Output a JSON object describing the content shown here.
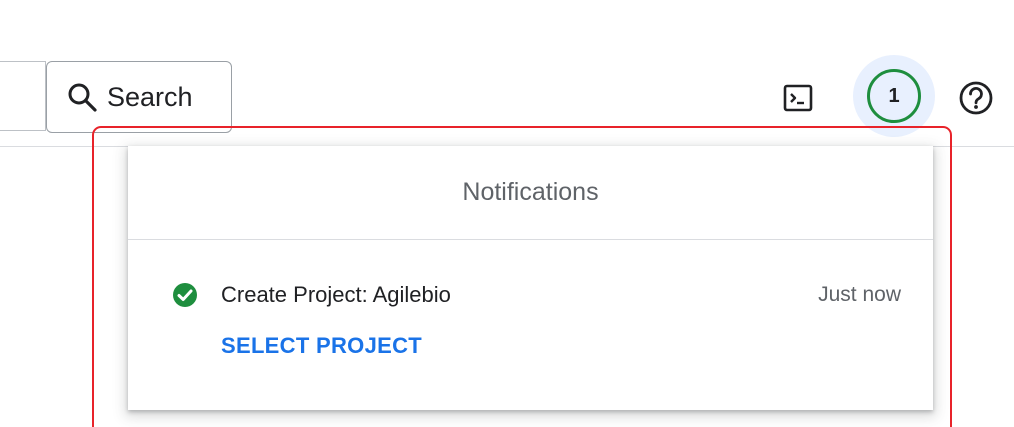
{
  "header": {
    "search": {
      "label": "Search",
      "icon": "search-icon"
    },
    "notifications": {
      "count": "1",
      "ring_color": "#1e8e3e"
    },
    "terminal_icon": "terminal-icon",
    "help_icon": "help-icon"
  },
  "notifications_panel": {
    "title": "Notifications",
    "items": [
      {
        "status": "success",
        "status_color": "#1e8e3e",
        "title": "Create Project: Agilebio",
        "time": "Just now",
        "action": "SELECT PROJECT",
        "action_color": "#1a73e8"
      }
    ]
  },
  "highlight": {
    "color": "#e8232a"
  }
}
